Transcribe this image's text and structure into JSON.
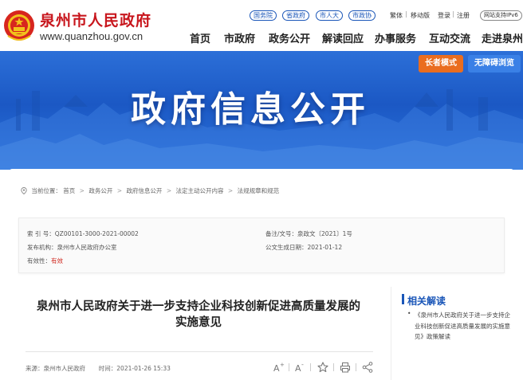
{
  "header": {
    "site_title": "泉州市人民政府",
    "site_url": "www.quanzhou.gov.cn",
    "gov_links": [
      "国务院",
      "省政府",
      "市人大",
      "市政协"
    ],
    "utility": {
      "traditional": "繁体",
      "mobile": "移动版",
      "login": "登录",
      "register": "注册",
      "ipv6": "网站支持IPv6"
    },
    "nav": [
      "首页",
      "市政府",
      "政务公开",
      "解读回应",
      "办事服务",
      "互动交流",
      "走进泉州"
    ]
  },
  "banner": {
    "title": "政府信息公开",
    "elder_mode": "长者模式",
    "accessible": "无障碍浏览"
  },
  "breadcrumb": {
    "label": "当前位置：",
    "items": [
      "首页",
      "政务公开",
      "政府信息公开",
      "法定主动公开内容",
      "法规规章和规范"
    ]
  },
  "meta": {
    "index_label": "索 引 号：",
    "index_value": "QZ00101-3000-2021-00002",
    "issuer_label": "发布机构：",
    "issuer_value": "泉州市人民政府办公室",
    "validity_label": "有效性：",
    "validity_value": "有效",
    "docno_label": "备注/文号：",
    "docno_value": "泉政文〔2021〕1号",
    "date_label": "公文生成日期：",
    "date_value": "2021-01-12"
  },
  "article": {
    "title_line1": "泉州市人民政府关于进一步支持企业科技创新促进高质量发展的",
    "title_line2": "实施意见",
    "source_label": "来源：",
    "source_value": "泉州市人民政府",
    "time_label": "时间：",
    "time_value": "2021-01-26 15:33"
  },
  "sidebar": {
    "heading": "相关解读",
    "item": "《泉州市人民政府关于进一步支持企业科技创新促进高质量发展的实施意见》政策解读"
  },
  "colors": {
    "brand_red": "#c8161d",
    "link_blue": "#1a56b8",
    "elder_orange": "#ea6d1f",
    "banner_blue": "#1b58c4"
  }
}
